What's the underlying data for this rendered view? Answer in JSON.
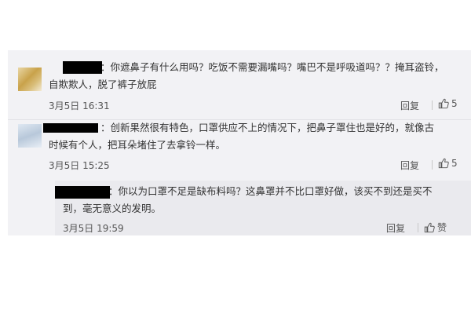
{
  "comments": [
    {
      "text_line1": "：你遮鼻子有什么用吗？吃饭不需要漏嘴吗？嘴巴不是呼吸道吗？？掩耳盗铃，",
      "text_line2": "自欺欺人，脱了裤子放屁",
      "time": "3月5日  16:31",
      "reply_label": "回复",
      "like_count": "5"
    },
    {
      "text_line1": "：创新果然很有特色，口罩供应不上的情况下，把鼻子罩住也是好的，就像古",
      "text_line2": "时候有个人，把耳朵堵住了去拿铃一样。",
      "time": "3月5日  15:25",
      "reply_label": "回复",
      "like_count": "5"
    }
  ],
  "reply": {
    "text_line1": "：你以为口罩不足是缺布料吗？这鼻罩并不比口罩好做，该买不到还是买不",
    "text_line2": "到，毫无意义的发明。",
    "time": "3月5日  19:59",
    "reply_label": "回复",
    "like_label": "赞"
  },
  "icons": {
    "like": "thumbs-up-icon"
  }
}
